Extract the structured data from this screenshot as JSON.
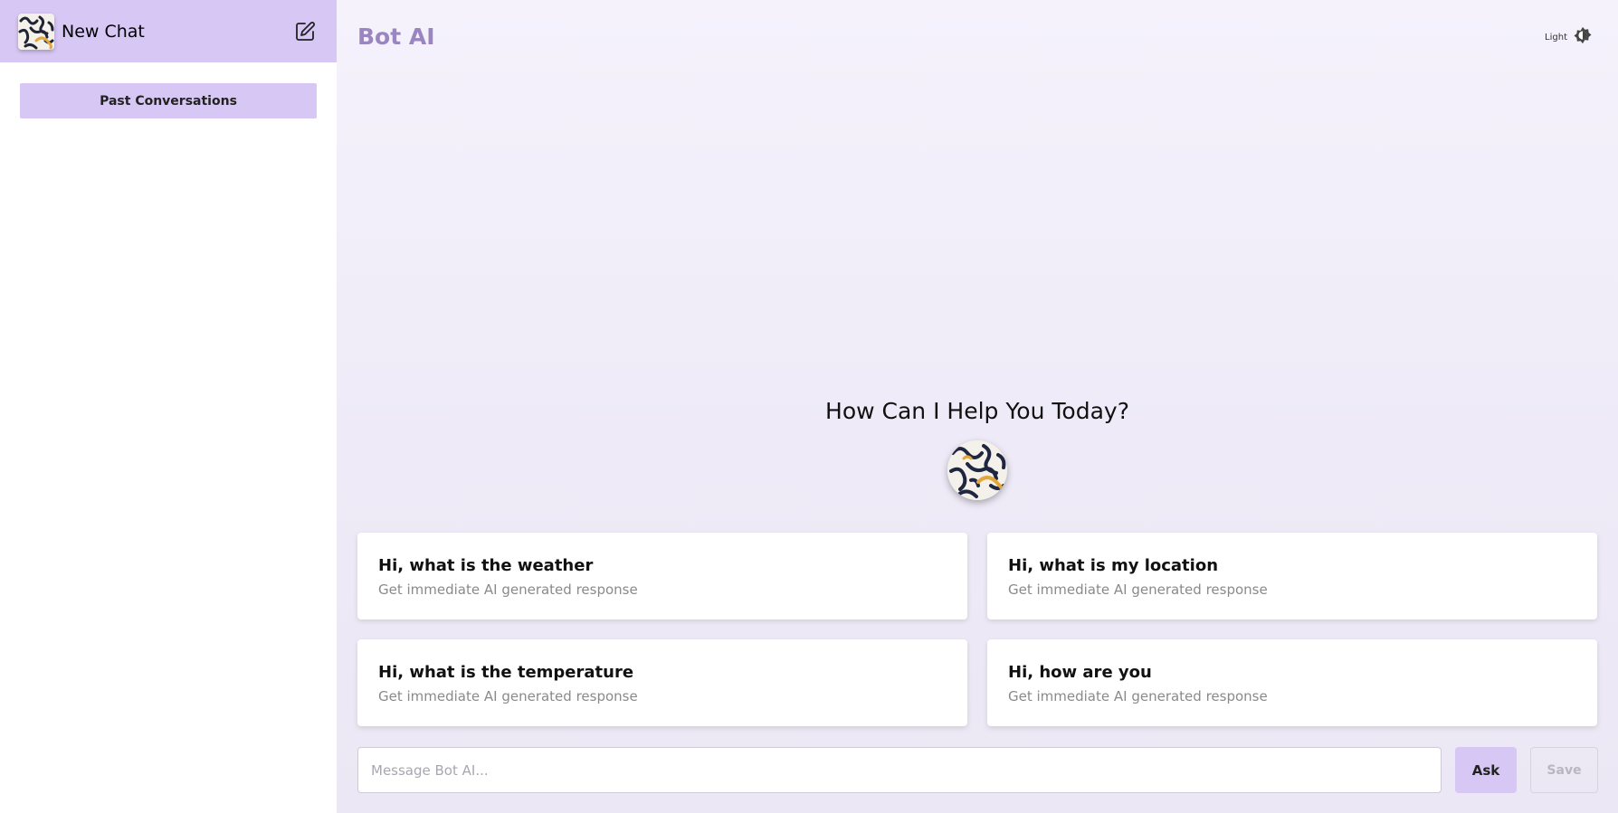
{
  "sidebar": {
    "title": "New Chat",
    "past_conversations_label": "Past Conversations",
    "logo_icon": "swirl-pattern-avatar",
    "edit_icon": "edit-icon"
  },
  "header": {
    "brand": "Bot AI",
    "theme_label": "Light",
    "theme_icon": "brightness-icon"
  },
  "welcome": {
    "heading": "How Can I Help You Today?",
    "avatar_icon": "swirl-pattern-avatar"
  },
  "suggestions": [
    {
      "title": "Hi, what is the weather",
      "subtitle": "Get immediate AI generated response"
    },
    {
      "title": "Hi, what is my location",
      "subtitle": "Get immediate AI generated response"
    },
    {
      "title": "Hi, what is the temperature",
      "subtitle": "Get immediate AI generated response"
    },
    {
      "title": "Hi, how are you",
      "subtitle": "Get immediate AI generated response"
    }
  ],
  "composer": {
    "placeholder": "Message Bot AI...",
    "value": "",
    "ask_label": "Ask",
    "save_label": "Save"
  },
  "colors": {
    "accent": "#d7c7f4",
    "brand": "#9b85c0",
    "background": "#f1edf9"
  }
}
